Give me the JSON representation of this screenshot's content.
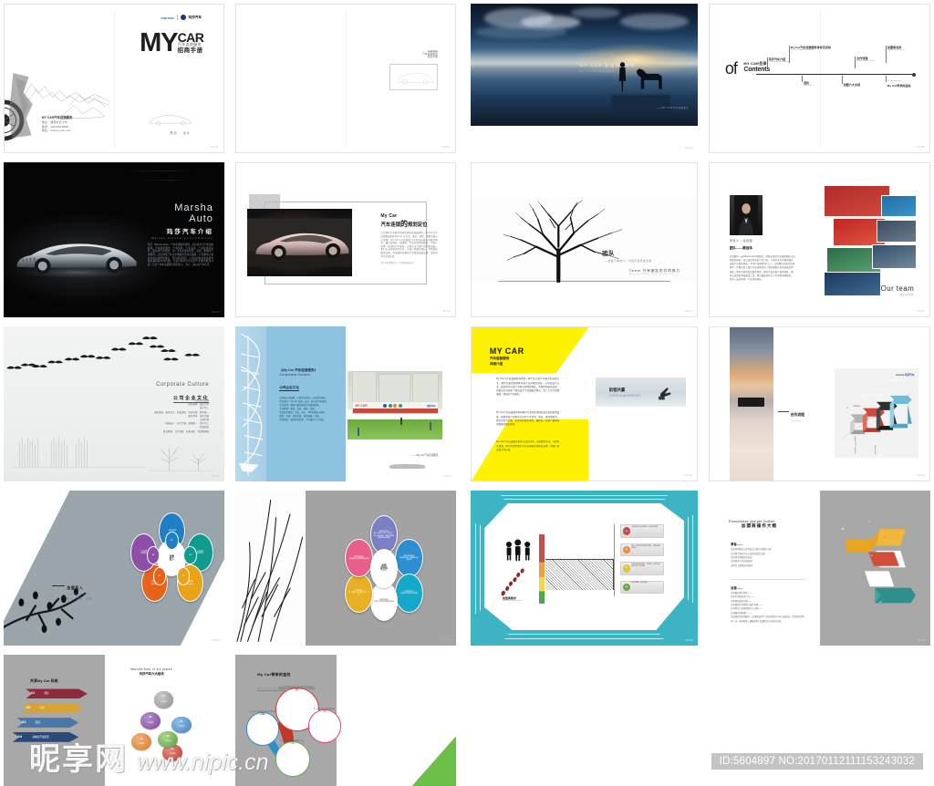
{
  "meta": {
    "watermark_cn": "昵享网",
    "watermark_url": "www.nipic.cn",
    "id_text": "ID:5604897 NO:20170112111153243032"
  },
  "pages": [
    {
      "id": "p1",
      "name": "cover",
      "logo_latin": "marsha",
      "logo_cn": "玛莎汽车",
      "title_my": "MY",
      "title_car": "CAR",
      "title_sub_cn": "汽车连锁服务",
      "title_sub_cn2": "招商手册",
      "info_head": "MY CAR汽车连锁服务",
      "info_line1": "地址：湖南省长沙市",
      "info_line2": "电话：400-888-8888",
      "info_line3": "网址：www.mycar.com",
      "footer": "策划 · 设计",
      "page_no": "01/02"
    },
    {
      "id": "p2",
      "name": "inside-cover",
      "brand_latin": "marsha",
      "brand_cn": "汽车连锁服务",
      "brand_cn2": "招商手册",
      "sub": "MY CAR",
      "page_no": "03/04"
    },
    {
      "id": "p3",
      "name": "night-photo-spread",
      "caption_cn": "MY CAR 前进风为梦想",
      "caption_en": "MY CAR的马车你的梦想",
      "signature": "——MY CAR汽车连锁服务",
      "page_no": "05/06"
    },
    {
      "id": "p4",
      "name": "contents",
      "of_word": "of",
      "title_en": "MY CAR目录",
      "title_cn": "Contents",
      "nodes": [
        {
          "t1": "玛莎汽车介绍",
          "t2": "Marsha Auto Introduction",
          "t3": "01"
        },
        {
          "t1": "My Car汽车连锁服务体系及目标",
          "t2": "My Car Corporate Culture",
          "t3": "02"
        },
        {
          "t1": "团队",
          "t2": "Our Team",
          "t3": "03"
        },
        {
          "t1": "合作流程",
          "t2": "Cooperation Process",
          "t3": "04"
        },
        {
          "t1": "加盟商支持",
          "t2": "Franchise Support",
          "t3": "05"
        },
        {
          "t1": "加盟六大支持",
          "t2": "Six Plates",
          "t3": "06"
        },
        {
          "t1": "My Car带来的益处",
          "t2": "Our Advantages",
          "t3": "07"
        }
      ],
      "page_no": "07/08"
    },
    {
      "id": "p5",
      "name": "marsha-auto-intro",
      "title_line1": "Marsha",
      "title_line2": "Auto",
      "title_cn": "玛莎汽车介绍",
      "title_en": "Marsha AutoCars Introduction",
      "body": "玛莎（Marsha Auto）汽车连锁服务机构，主营业务为汽车美容装饰、汽车养护服务、汽车保险、汽车美容、汽车装潢等业务。集多年行业经验，为广大车主提供优质、高效、便捷的汽车服务，打造中国汽车后市场服务的知名品牌。公司秉承以客户为中心的经营理念，坚持诚信经营，以专业的技术和优质的服务赢得客户的信赖，为客户提供全方位的汽车服务解决方案，让每一位车主都能享受到安心、省心、放心的汽车生活。",
      "page_no": "09/10"
    },
    {
      "id": "p6",
      "name": "my-car-plan",
      "title_en": "My Car",
      "title_cn1": "汽车连锁",
      "title_big": "的",
      "title_cn2": "规划定位",
      "body": "针对现代汽车服务市场的现状和发展趋势，My Car汽车连锁服务机构 My Car 以专业、诚信、创新、共赢为核心价值观，My Car汽车连锁致力于打造标准化的服务体系，通过品牌化、规模化、专业化的经营模式，为客户提供一站式的汽车服务，实现企业与客户的共赢发展。我们以市场需求为导向，以客户满意为目标，不断提升服务品质，打造值得信赖的汽车服务连锁品牌，努力成为行业领先者。",
      "note": "“My Car品牌定位，汽车服务新标杆”",
      "page_no": "11/12"
    },
    {
      "id": "p7",
      "name": "team-tree",
      "title_cn": "团队",
      "subtitle": "——最懂汽车的人，为您打造专属方案",
      "en_title": "Team",
      "en_cn": "只有团队的共同努力",
      "en_sub": "Meet the hardest, only the very best",
      "page_no": "13/14"
    },
    {
      "id": "p8",
      "name": "our-team",
      "person_name": "李建义 | 总经理",
      "section": "团队——最强体",
      "body": "公司拥有一支Marsha Auto 精英的、经验丰富的专业管理团队与技术服务团队，核心成员均来自汽车行业，大部分来自于国内知名连锁汽车服务机构，平均行业经验5年以上；公司拥有完善的培训体系，定期对员工进行专业技能培训；拥有国家认证的高级技师团队；拥有完善的售后服务体系；拥有专业的客户服务团队；拥有先进的检测设备和工具；我们始终坚持以人为本的管理理念，打造一支高素质、专业化的团队。",
      "our_team_en": "Our team",
      "our_team_sub": "我们的团队",
      "page_no": "15/16"
    },
    {
      "id": "p9",
      "name": "corporate-culture-birds",
      "title_en": "Corporate Culture",
      "title_cn": "公司企业文化",
      "body": "公司的价值观\n团队精神　诚信立本\n客户至上\n创新发展　服务为先　开拓进取　追求卓越　勇争第一\n服务为本　诚信为根\n以客为尊\n团结奋斗　执行力强　质量第一　用户至上\n持续改进\n敬业精神　合作共赢　开拓创新　共创辉煌路",
      "page_no": "17/18"
    },
    {
      "id": "p10",
      "name": "corporate-culture-store",
      "title_line1": "《My Car 汽车连锁服务》",
      "title_line2": "Corporate Culture",
      "title_line3": "公司企业文化",
      "body": "企业核心价值观：以需求为导向，以市场为依托。\n企业使命：My Car 连锁，安全、放心的汽车服务。\n企业愿景：做客户最信赖的汽车服务机构。\n企业精神：团结、务实、创新、高效。\n企业服务理念：专业、用心、365天的贴心服务。\n理念：务实、追求卓越、创新发展、共赢。\n经营理念：诚信经营为本、汽车服务人人可及。",
      "caption": "——My Car汽车连锁服务",
      "store_sign": "MY CAR",
      "store_brand_cn": "玛莎汽车",
      "page_no": "19/20"
    },
    {
      "id": "p11",
      "name": "mycar-detail",
      "title_en": "MY CAR",
      "title_cn1": "汽车连锁服务",
      "title_cn2": "详细介绍",
      "body1": "My Car汽车连锁服务机构是一家专业从事汽车服务的连锁企业，拥有完善的管理体系和专业的服务团队。公司自成立以来，始终坚持以客户为中心的经营理念，不断提升服务品质，目前已在全国多个城市设立了连锁服务网点，为广大车主提供便捷、优质的汽车服务。",
      "body2": "My Car汽车连锁服务机构拥有专业的技术团队和先进的检测设备，能够为客户提供全方位的汽车检测、维修、保养等服务。我们坚持专业化、标准化的服务流程，确保每一位客户都能获得满意的服务体验。",
      "body3": "My Car汽车连锁服务机构以诚信为本，以质量求生存，以创新求发展，努力打造中国汽车后市场服务的知名品牌，为客户创造更大的价值。",
      "photo_cn": "前程共赢",
      "photo_en": "infocooperation",
      "page_no": "21/22"
    },
    {
      "id": "p12",
      "name": "cooperation-process",
      "caption_cn": "合作流程",
      "caption_en": "Co-operation",
      "chart_logo_latin": "marsha",
      "chart_logo_cn": "玛莎汽车",
      "arrows": [
        {
          "step": "01",
          "label": "项目咨询"
        },
        {
          "step": "02",
          "label": "意向洽谈 / 实地考察 / 资质审核确认"
        },
        {
          "step": "03",
          "label": "签订合作协议"
        },
        {
          "step": "04",
          "label": "店面选址与装修设计 / 设备配置 / 人员培训（筹备）"
        },
        {
          "step": "05",
          "label": "开业筹备与My Car总部支持"
        },
        {
          "step": "06",
          "label": "正式开业运营"
        }
      ],
      "page_no": "23/24"
    },
    {
      "id": "p13",
      "name": "franchise-investment",
      "caption_cn": "加盟投入",
      "caption_en": "Franchise investment",
      "caption_sub": "投入 · 回报 · 共赢",
      "hub_cn1": "加盟",
      "hub_cn2": "投入",
      "petals": [
        {
          "num": "01",
          "label": "品牌使用费",
          "color": "#1f7ec4"
        },
        {
          "num": "02",
          "label": "店面租金\n与装修投入",
          "color": "#0f9b8e"
        },
        {
          "num": "03",
          "label": "设备采购\n与工具投入",
          "color": "#e8a317"
        },
        {
          "num": "04",
          "label": "首批物料\n与备件投入",
          "color": "#e8631a"
        },
        {
          "num": "05",
          "label": "人员招聘\n与培训投入",
          "color": "#8e4fa8"
        }
      ],
      "page_no": "25/26"
    },
    {
      "id": "p14",
      "name": "franchise-support-flower",
      "hub_line1": "加盟",
      "hub_line2": "商支持",
      "hub_line3": "Support",
      "petals": [
        {
          "label": "品牌形象支持\n统一VI系统、统一门店形象、统一服务标准，总部提供全套品牌视觉识别系统",
          "color": "#7b7fc4"
        },
        {
          "label": "选址与装修支持\n专业选址评估、店面装修设计方案提供",
          "color": "#2e8fd0"
        },
        {
          "label": "技术培训支持\n定期技术培训与认证考核",
          "color": "#16a8c8"
        },
        {
          "label": "市场营销支持\n区域广告投放与促销活动支持",
          "color": "#ffffff"
        },
        {
          "label": "供应链支持\n统一采购、统一配送、统一价格",
          "color": "#e8b024"
        },
        {
          "label": "运营管理支持\n驻店指导与日常运营管理咨询",
          "color": "#e8608a"
        }
      ],
      "page_no": "27/28"
    },
    {
      "id": "p15",
      "name": "franchise-standard",
      "caption_cn": "加盟商要求",
      "caption_en": "Franchisee requirements",
      "cards": [
        {
          "num": "01",
          "text": "认同品牌文化与经营理念，具有创业激情。",
          "color": "#c0504d"
        },
        {
          "num": "02",
          "text": "具有一定的经济实力和投资能力，能够承担经营风险。",
          "color": "#e8913d"
        },
        {
          "num": "03",
          "text": "具备良好的商业信誉，在当地有一定的社会资源与人脉，守法经营。",
          "color": "#e0c53a"
        },
        {
          "num": "04",
          "text": "服从总部统一管理与指导。",
          "color": "#6aa84f"
        }
      ],
      "page_no": "29/30"
    },
    {
      "id": "p16",
      "name": "franchise-outline",
      "title_en": "Franchisees operate Outline",
      "title_cn": "加盟商操作大纲",
      "section1_head": "筹备——",
      "section1_items": [
        "您如何判断自己是否适合从事汽车服务行业？",
        "您在哪个城市开店以及选址是否合适？",
        "您的资金预算是否充足？",
        "您需要多大的店面面积？",
        "您的员工配置如何规划？"
      ],
      "section2_head": "运营——",
      "section2_items": [
        "如何做好客户服务——",
        "如何打造团队执行力——",
        "如何做好成本控制——",
        "如何做好库存管理与配件采购——",
        "如何提升门店盈利能力与口碑——",
        "如何做好营销推广——",
        "您如果还有其他疑问，总部将安排专门的运营督导人员与您对接，为您提供全程的一对一指导服务，确保您的门店顺利开业并稳定运营。"
      ],
      "page_no": "31/32"
    },
    {
      "id": "p17",
      "name": "six-plates",
      "left_head": "共享My Car 系统",
      "arrows": [
        {
          "num": "01",
          "label": "理念",
          "color": "#8d2b3c"
        },
        {
          "num": "02",
          "label": "车型",
          "color": "#d8a334"
        },
        {
          "num": "03",
          "label": "配送",
          "color": "#4a77a8"
        },
        {
          "num": "04",
          "label": "系统的开发配置",
          "color": "#2b4a7c"
        }
      ],
      "right_head_en": "Marsha Auto of six plates",
      "right_head_cn": "玛莎汽车六大板块",
      "nodes": [
        {
          "n": "01",
          "t": "汽车美容",
          "color": "#9b9b9b"
        },
        {
          "n": "02",
          "t": "汽车装饰",
          "color": "#8e5fa8"
        },
        {
          "n": "03",
          "t": "汽车养护",
          "color": "#3f82c4"
        },
        {
          "n": "04",
          "t": "汽车保险",
          "color": "#d95040"
        },
        {
          "n": "05",
          "t": "汽车维修",
          "color": "#e88a3a"
        },
        {
          "n": "06",
          "t": "汽车用品",
          "color": "#6aa84f"
        }
      ],
      "page_no": "33/34"
    },
    {
      "id": "p18",
      "name": "benefits",
      "title_cn": "My Car带来的益处",
      "title_en": "My Car The advantage",
      "pins": [
        {
          "num": "01",
          "text": "My Car汽车连锁服务机构为您提供完整的品牌支持体系，助您快速进入汽车服务市场，降低创业风险，实现稳定盈利。",
          "color": "#d93a2b"
        },
        {
          "num": "02",
          "text": "My Car汽车连锁服务机构提供全面培训与技术支持。",
          "color": "#2e8fd0"
        },
        {
          "num": "03",
          "text": "统一采购与配送，降低运营成本。",
          "color": "#e0407f"
        },
        {
          "num": "04",
          "text": "强大的营销支持，助您快速打开市场。",
          "color": "#6aa84f"
        }
      ],
      "page_no": "35/36"
    }
  ]
}
